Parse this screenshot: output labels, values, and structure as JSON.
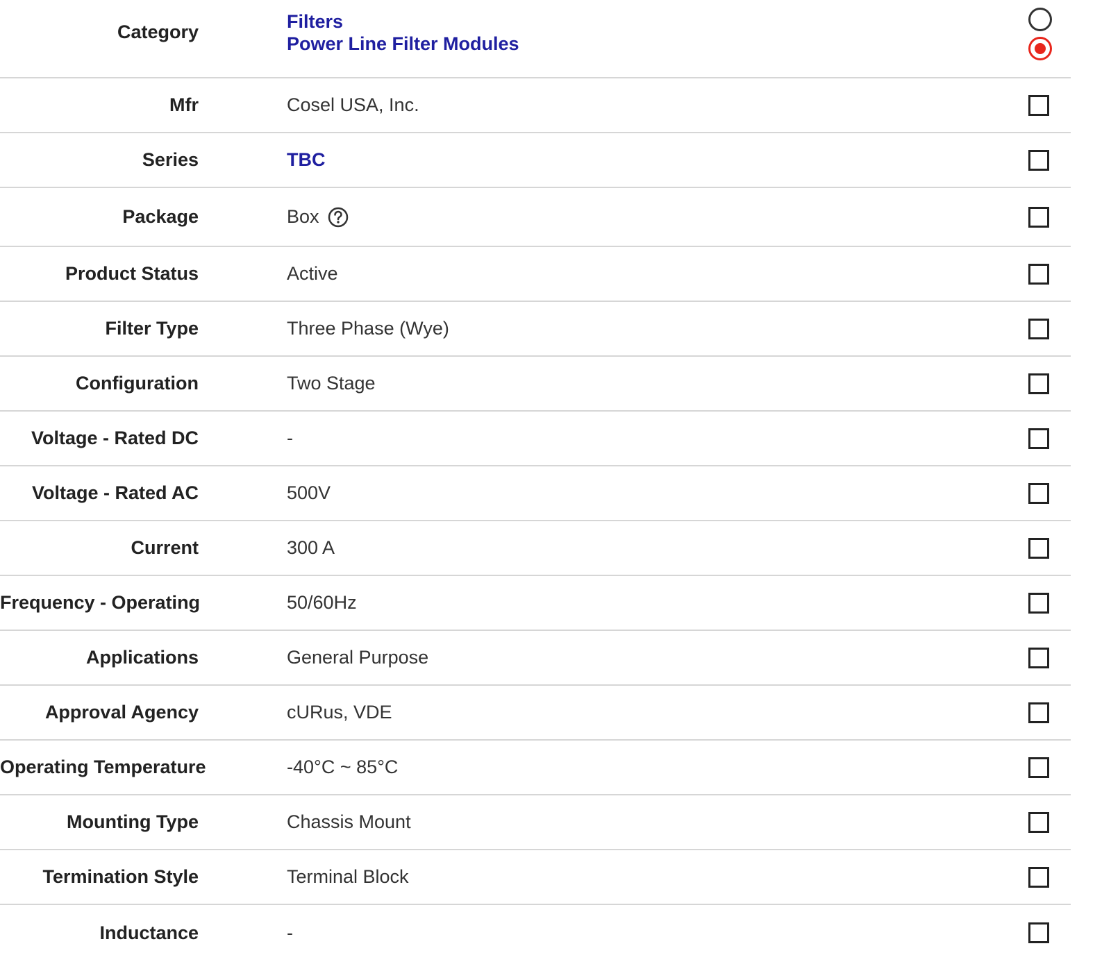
{
  "category": {
    "label": "Category",
    "links": [
      "Filters",
      "Power Line Filter Modules"
    ],
    "selected_index": 1
  },
  "rows": [
    {
      "label": "Mfr",
      "value": "Cosel USA, Inc.",
      "link": false
    },
    {
      "label": "Series",
      "value": "TBC",
      "link": true
    },
    {
      "label": "Package",
      "value": "Box",
      "link": false,
      "help": true
    },
    {
      "label": "Product Status",
      "value": "Active",
      "link": false
    },
    {
      "label": "Filter Type",
      "value": "Three Phase (Wye)",
      "link": false
    },
    {
      "label": "Configuration",
      "value": "Two Stage",
      "link": false
    },
    {
      "label": "Voltage - Rated DC",
      "value": "-",
      "link": false
    },
    {
      "label": "Voltage - Rated AC",
      "value": "500V",
      "link": false
    },
    {
      "label": "Current",
      "value": "300 A",
      "link": false
    },
    {
      "label": "Frequency - Operating",
      "value": "50/60Hz",
      "link": false
    },
    {
      "label": "Applications",
      "value": "General Purpose",
      "link": false
    },
    {
      "label": "Approval Agency",
      "value": "cURus, VDE",
      "link": false
    },
    {
      "label": "Operating Temperature",
      "value": "-40°C ~ 85°C",
      "link": false
    },
    {
      "label": "Mounting Type",
      "value": "Chassis Mount",
      "link": false
    },
    {
      "label": "Termination Style",
      "value": "Terminal Block",
      "link": false
    },
    {
      "label": "Inductance",
      "value": "-",
      "link": false
    }
  ],
  "colors": {
    "link": "#1f1fa0",
    "radio_selected": "#e8261c",
    "divider": "#d6d6d6"
  },
  "icons": {
    "help": "question-circle-icon"
  }
}
